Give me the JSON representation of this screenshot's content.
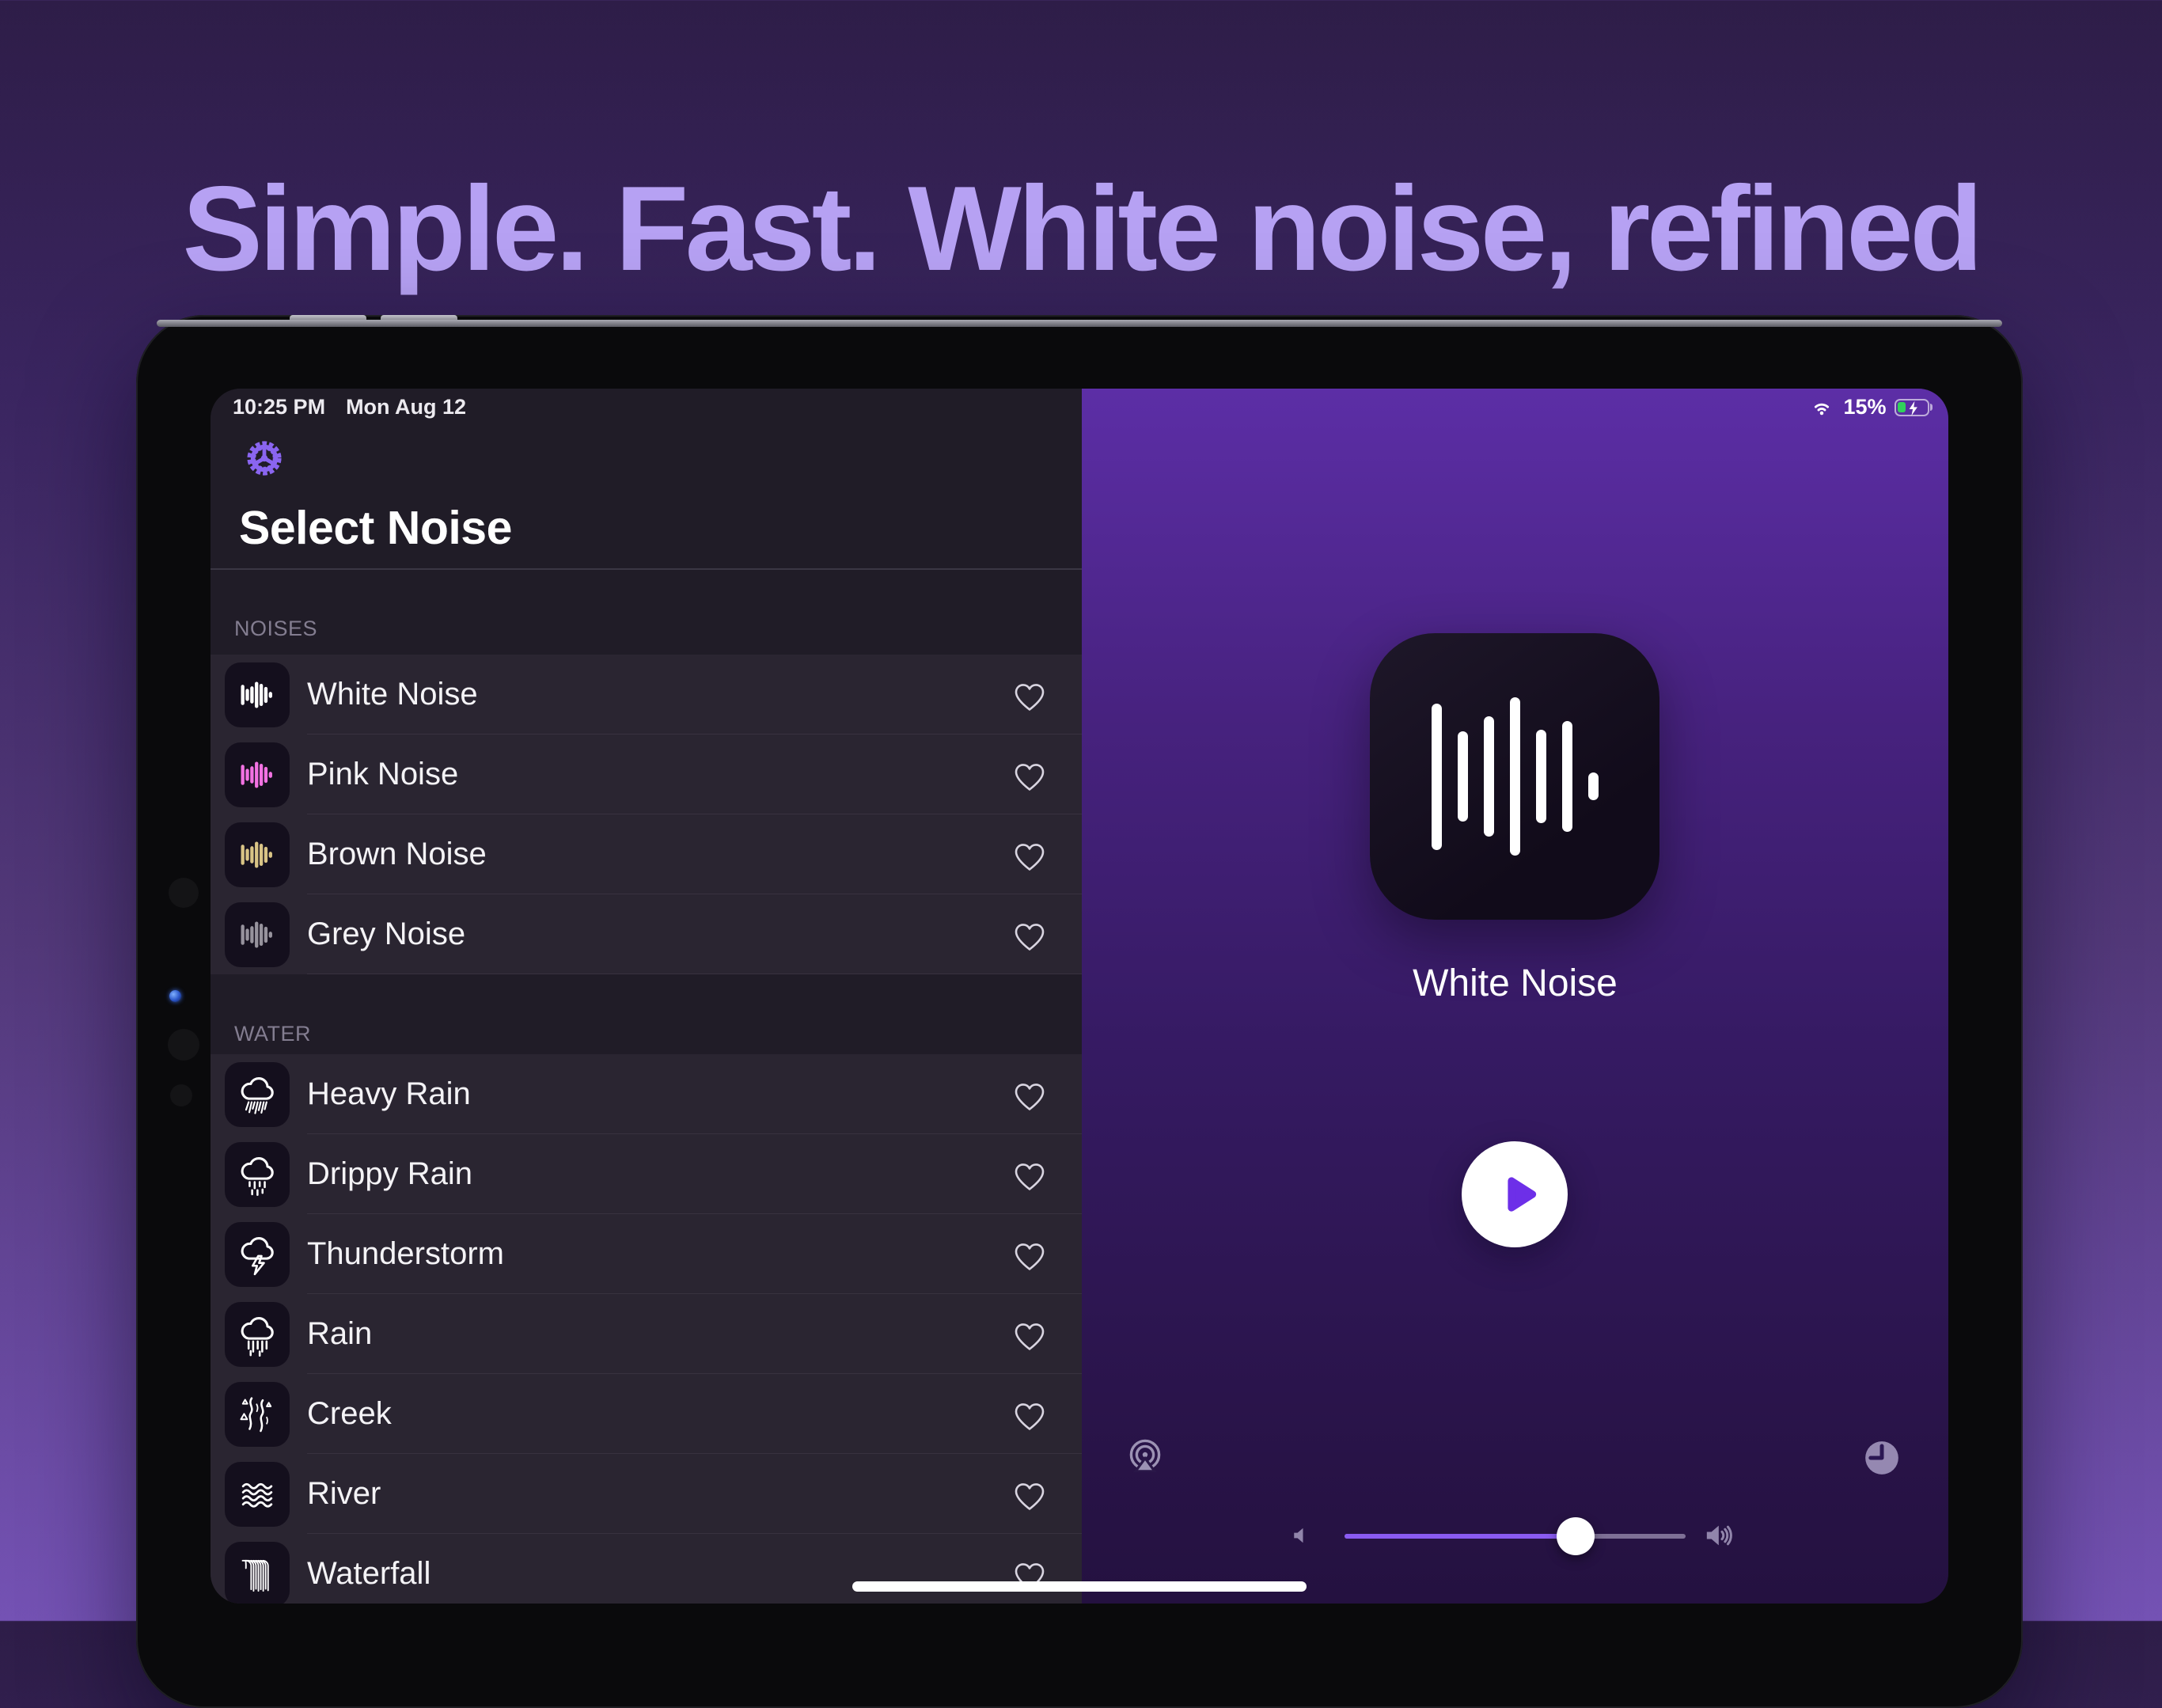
{
  "headline": "Simple. Fast. White noise, refined",
  "device": {
    "status_bar": {
      "time": "10:25 PM",
      "date": "Mon Aug 12",
      "battery_percent": "15%",
      "battery_fill_color": "#31d15b",
      "charging": "charging-bolt"
    },
    "nav": {
      "title": "Select Noise"
    },
    "list": {
      "sections": [
        {
          "header": "NOISES",
          "items": [
            {
              "label": "White Noise",
              "icon": "waveform",
              "icon_color": "#ffffff"
            },
            {
              "label": "Pink Noise",
              "icon": "waveform",
              "icon_color": "#f272e2"
            },
            {
              "label": "Brown Noise",
              "icon": "waveform",
              "icon_color": "#d9c486"
            },
            {
              "label": "Grey Noise",
              "icon": "waveform",
              "icon_color": "#97939d"
            }
          ]
        },
        {
          "header": "WATER",
          "items": [
            {
              "label": "Heavy Rain",
              "icon": "heavy-rain",
              "icon_color": "#ffffff"
            },
            {
              "label": "Drippy Rain",
              "icon": "drippy-rain",
              "icon_color": "#ffffff"
            },
            {
              "label": "Thunderstorm",
              "icon": "thunderstorm",
              "icon_color": "#ffffff"
            },
            {
              "label": "Rain",
              "icon": "rain",
              "icon_color": "#ffffff"
            },
            {
              "label": "Creek",
              "icon": "creek",
              "icon_color": "#ffffff"
            },
            {
              "label": "River",
              "icon": "river",
              "icon_color": "#ffffff"
            },
            {
              "label": "Waterfall",
              "icon": "waterfall",
              "icon_color": "#ffffff"
            }
          ]
        }
      ]
    },
    "player": {
      "title": "White Noise",
      "play_color": "#6d2fe8",
      "slider_fill_color": "#8a5bf2"
    },
    "accent_color": "#8a65f0"
  }
}
